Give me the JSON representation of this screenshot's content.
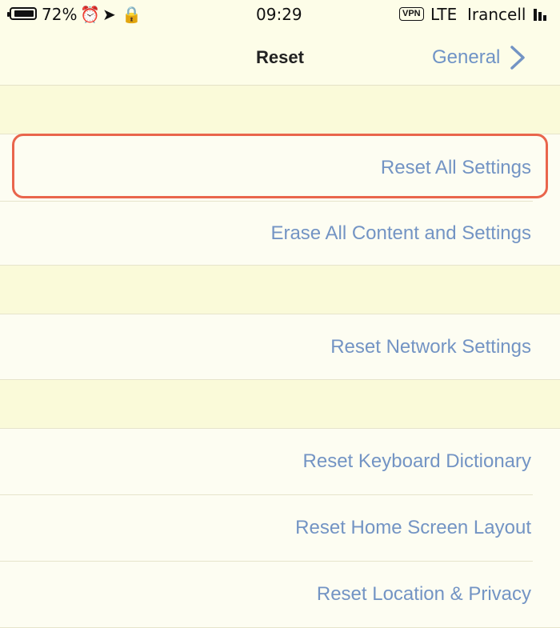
{
  "status_bar": {
    "carrier": "Irancell",
    "network": "LTE",
    "vpn_badge": "VPN",
    "time": "09:29",
    "battery_percent": "72%",
    "battery_level": 0.72
  },
  "nav": {
    "title": "Reset",
    "back_label": "General"
  },
  "sections": [
    {
      "items": [
        {
          "label": "Reset All Settings",
          "highlighted": true
        },
        {
          "label": "Erase All Content and Settings"
        }
      ]
    },
    {
      "items": [
        {
          "label": "Reset Network Settings"
        }
      ]
    },
    {
      "items": [
        {
          "label": "Reset Keyboard Dictionary"
        },
        {
          "label": "Reset Home Screen Layout"
        },
        {
          "label": "Reset Location & Privacy"
        }
      ]
    }
  ],
  "colors": {
    "link": "#7394c4",
    "background": "#fdfdf2",
    "group_gap": "#fafad9",
    "highlight": "#e9654c"
  }
}
